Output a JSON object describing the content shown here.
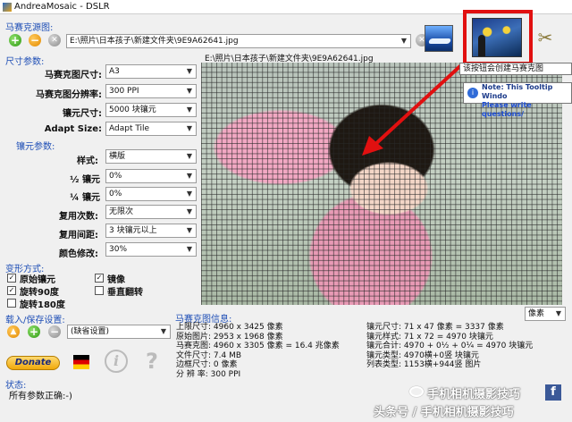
{
  "window": {
    "title": "AndreaMosaic - DSLR"
  },
  "source": {
    "section_label": "马赛克源图:",
    "path": "E:\\照片\\日本孩子\\新建文件夹\\9E9A62641.jpg",
    "image_caption": "E:\\照片\\日本孩子\\新建文件夹\\9E9A62641.jpg"
  },
  "size": {
    "section_label": "尺寸参数:",
    "mosaic_size_label": "马赛克图尺寸:",
    "mosaic_size_value": "A3",
    "resolution_label": "马赛克图分辨率:",
    "resolution_value": "300 PPI",
    "tile_size_label": "镶元尺寸:",
    "tile_size_value": "5000 块镶元",
    "adapt_label": "Adapt Size:",
    "adapt_value": "Adapt Tile"
  },
  "tile": {
    "section_label": "镶元参数:",
    "style_label": "样式:",
    "style_value": "横版",
    "half_label": "½ 镶元",
    "half_value": "0%",
    "quarter_label": "¼ 镶元",
    "quarter_value": "0%",
    "reuse_label": "复用次数:",
    "reuse_value": "无限次",
    "reuse_dist_label": "复用间距:",
    "reuse_dist_value": "3 块镶元以上",
    "color_label": "颜色修改:",
    "color_value": "30%"
  },
  "transform": {
    "section_label": "变形方式:",
    "original": "原始镶元",
    "mirror": "镜像",
    "rotate90": "旋转90度",
    "vflip": "垂直翻转",
    "rotate180": "旋转180度"
  },
  "settings": {
    "section_label": "载入/保存设置:",
    "value": "(缺省设置)"
  },
  "donate_label": "Donate",
  "status": {
    "section_label": "状态:",
    "text": "所有参数正确:-)"
  },
  "tooltip": {
    "main": "该按钮会创建马赛克图",
    "note": "Note: This Tooltip Windo",
    "link": "Please write questions/"
  },
  "units_value": "像素",
  "info": {
    "section_label": "马赛克图信息:",
    "left": [
      "上限尺寸: 4960 x 3425 像素",
      "原始图片: 2953 x 1968 像素",
      "马赛克图: 4960 x 3305 像素 = 16.4 兆像素",
      "文件尺寸: 7.4 MB",
      "边框尺寸: 0 像素",
      "分 辨 率: 300 PPI"
    ],
    "right": [
      "镶元尺寸: 71 x 47 像素 = 3337 像素",
      "镶元样式: 71 x 72 = 4970 块镶元",
      "镶元合计: 4970 + 0½ + 0¼ = 4970 块镶元",
      "镶元类型: 4970横+0竖 块镶元",
      "列表类型: 1153横+944竖 图片"
    ]
  },
  "watermark": {
    "line1": "手机相机摄影技巧",
    "line2": "头条号 / 手机相机摄影技巧"
  },
  "colors": {
    "section": "#1f4fb6",
    "highlight": "#e11010"
  }
}
